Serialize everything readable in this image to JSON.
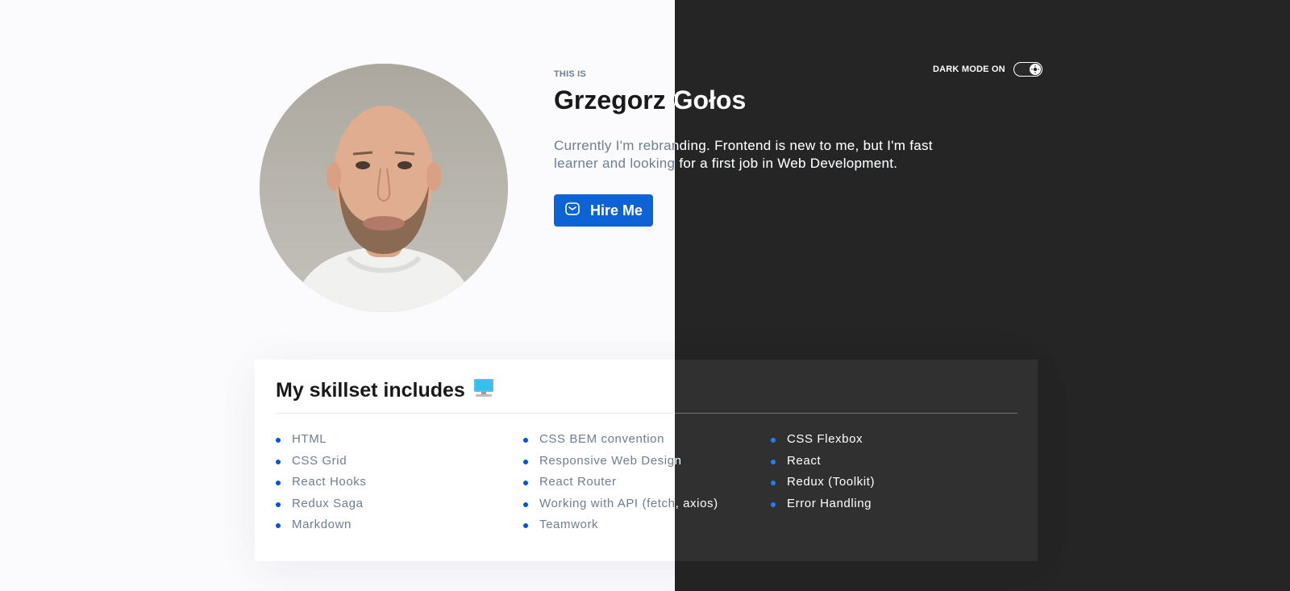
{
  "theme_toggle": {
    "label": "DARK MODE ON",
    "enabled": true,
    "icon": "sun-icon"
  },
  "header": {
    "eyebrow": "THIS IS",
    "name": "Grzegorz Gołos",
    "bio": "Currently I'm rebranding. Frontend is new to me, but I'm fast learner and looking for a first job in Web Development.",
    "hire_button": {
      "label": "Hire Me",
      "icon": "mail-icon"
    }
  },
  "skills": {
    "title": "My skillset includes",
    "title_icon": "computer-monitor-icon",
    "columns": [
      [
        "HTML",
        "CSS Grid",
        "React Hooks",
        "Redux Saga",
        "Markdown"
      ],
      [
        "CSS BEM convention",
        "Responsive Web Design",
        "React Router",
        "Working with API (fetch, axios)",
        "Teamwork"
      ],
      [
        "CSS Flexbox",
        "React",
        "Redux (Toolkit)",
        "Error Handling"
      ]
    ]
  },
  "colors": {
    "accent": "#0d63d6",
    "light_bg": "#fbfbfe",
    "dark_bg": "#252525",
    "dark_card": "#303030",
    "text_muted": "#6e7e91"
  }
}
